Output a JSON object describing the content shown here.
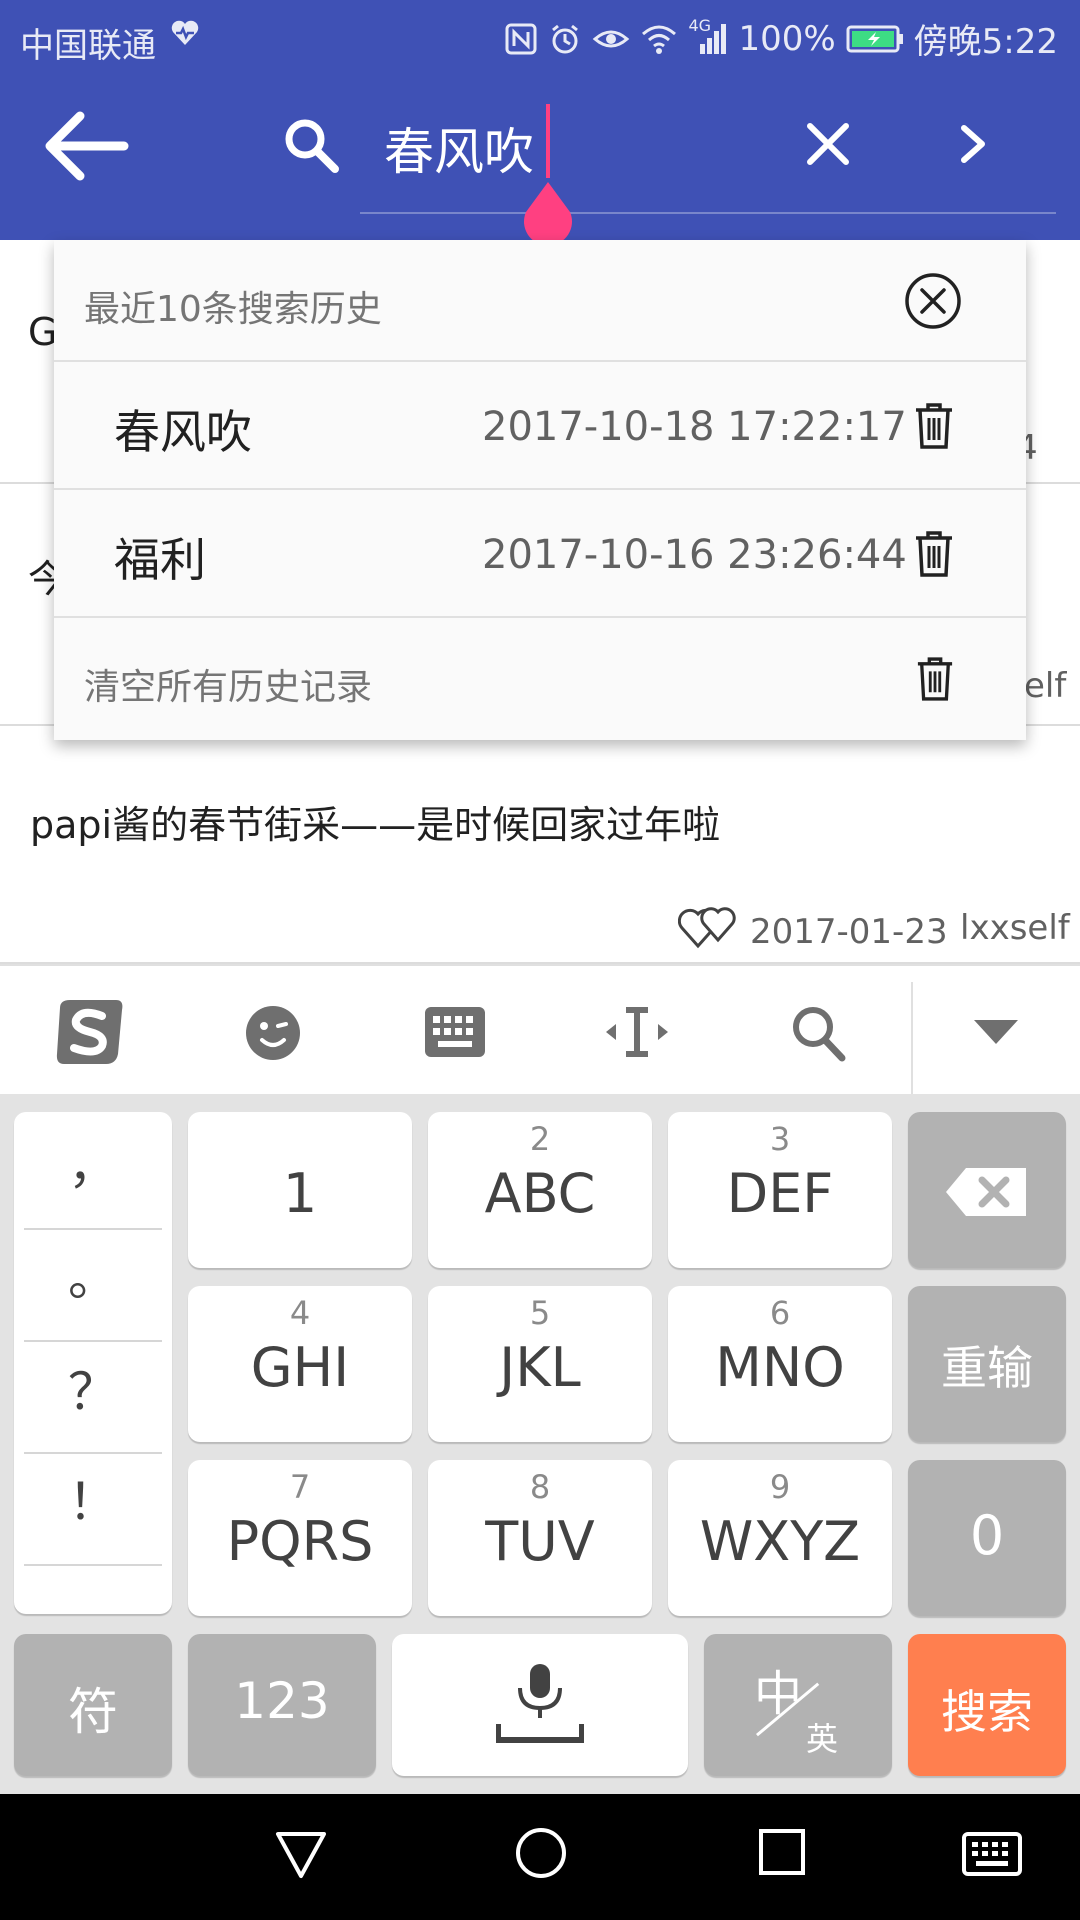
{
  "status_bar": {
    "carrier": "中国联通",
    "battery_percent": "100%",
    "time": "傍晚5:22",
    "network": "4G"
  },
  "search": {
    "query": "春风吹"
  },
  "results": [
    {
      "title": "G",
      "meta": "4"
    },
    {
      "title": "今",
      "meta": "elf"
    },
    {
      "title": "papi酱的春节街采——是时候回家过年啦",
      "date": "2017-01-23",
      "author": "lxxself"
    }
  ],
  "history": {
    "header": "最近10条搜索历史",
    "items": [
      {
        "term": "春风吹",
        "time": "2017-10-18 17:22:17"
      },
      {
        "term": "福利",
        "time": "2017-10-16 23:26:44"
      }
    ],
    "clear_all": "清空所有历史记录"
  },
  "keyboard": {
    "punctuation": [
      "，",
      "。",
      "？",
      "！"
    ],
    "keys": [
      {
        "num": "",
        "label": "1"
      },
      {
        "num": "2",
        "label": "ABC"
      },
      {
        "num": "3",
        "label": "DEF"
      },
      {
        "num": "4",
        "label": "GHI"
      },
      {
        "num": "5",
        "label": "JKL"
      },
      {
        "num": "6",
        "label": "MNO"
      },
      {
        "num": "7",
        "label": "PQRS"
      },
      {
        "num": "8",
        "label": "TUV"
      },
      {
        "num": "9",
        "label": "WXYZ"
      }
    ],
    "reenter": "重输",
    "zero": "0",
    "symbols": "符",
    "numbers": "123",
    "lang_zh": "中",
    "lang_en": "英",
    "search": "搜索"
  },
  "colors": {
    "primary": "#3f51b5",
    "accent": "#ff4081",
    "search_key": "#ff7f4f"
  }
}
